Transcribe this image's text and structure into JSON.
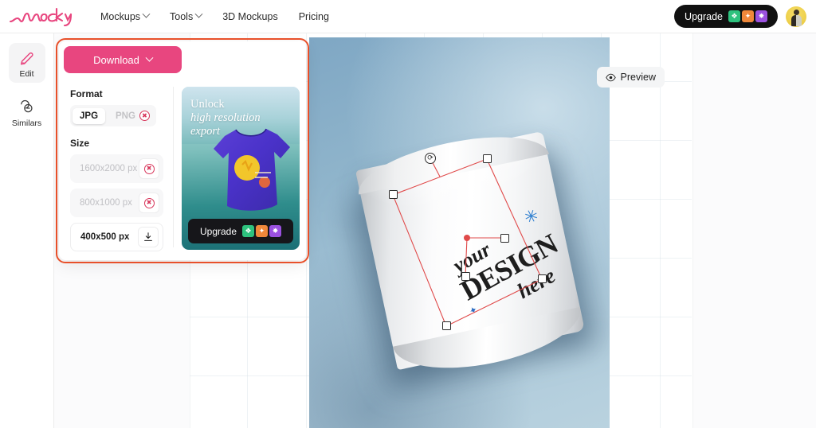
{
  "header": {
    "logo_text": "mockey",
    "nav": [
      {
        "label": "Mockups",
        "has_caret": true
      },
      {
        "label": "Tools",
        "has_caret": true
      },
      {
        "label": "3D Mockups",
        "has_caret": false
      },
      {
        "label": "Pricing",
        "has_caret": false
      }
    ],
    "upgrade_label": "Upgrade",
    "chips": [
      "❖",
      "✦",
      "✸"
    ],
    "avatar_name": "user-avatar"
  },
  "rail": {
    "items": [
      {
        "label": "Edit",
        "icon": "pencil-icon",
        "active": true
      },
      {
        "label": "Similars",
        "icon": "similars-icon",
        "active": false
      }
    ]
  },
  "panel": {
    "download_label": "Download",
    "format": {
      "title": "Format",
      "options": [
        {
          "label": "JPG",
          "locked": false
        },
        {
          "label": "PNG",
          "locked": true
        }
      ]
    },
    "size": {
      "title": "Size",
      "options": [
        {
          "label": "1600x2000 px",
          "locked": true,
          "action": "locked-icon"
        },
        {
          "label": "800x1000 px",
          "locked": true,
          "action": "locked-icon"
        },
        {
          "label": "400x500 px",
          "locked": false,
          "action": "download-icon"
        }
      ]
    },
    "promo": {
      "line1": "Unlock",
      "line2": "high resolution",
      "line3": "export",
      "cta_label": "Upgrade",
      "cta_chips": [
        "❖",
        "✦",
        "✸"
      ]
    }
  },
  "canvas": {
    "preview_label": "Preview",
    "preview_icon": "eye-icon",
    "design_text": {
      "line1": "your",
      "line2": "DESIGN",
      "line3": "here"
    },
    "sparkle_glyph": "✳",
    "sparkle_small_glyph": "✦",
    "rotate_glyph": "⟳"
  },
  "colors": {
    "brand_pink": "#e8467f",
    "highlight_orange": "#e8502a",
    "dark": "#111111",
    "selection_red": "#e04a4a",
    "sparkle_blue": "#2f7fd0"
  }
}
